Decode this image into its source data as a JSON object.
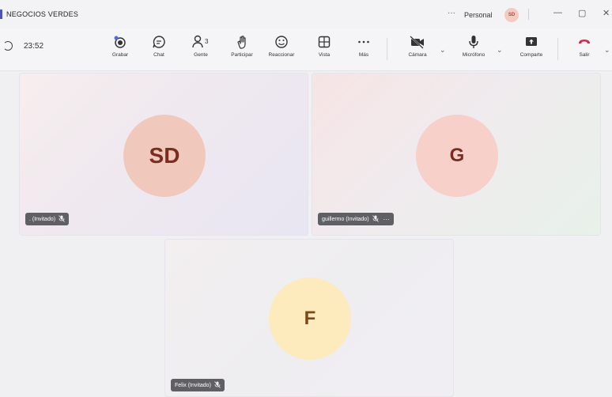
{
  "window": {
    "title": "NEGOCIOS VERDES",
    "more_label": "···",
    "account_label": "Personal",
    "account_initials": "SD",
    "minimize_glyph": "—",
    "maximize_glyph": "▢",
    "close_glyph": "✕"
  },
  "toolbar": {
    "elapsed_time": "23:52",
    "buttons": [
      {
        "label": "Grabar",
        "icon": "record-icon"
      },
      {
        "label": "Chat",
        "icon": "chat-icon"
      },
      {
        "label": "Gente",
        "icon": "people-icon",
        "badge": "3"
      },
      {
        "label": "Participar",
        "icon": "raise-hand-icon"
      },
      {
        "label": "Reaccionar",
        "icon": "smiley-icon"
      },
      {
        "label": "Vista",
        "icon": "grid-view-icon"
      },
      {
        "label": "Más",
        "icon": "more-icon"
      },
      {
        "label": "Cámara",
        "icon": "camera-off-icon"
      },
      {
        "label": "Micrófono",
        "icon": "microphone-icon"
      },
      {
        "label": "Comparte",
        "icon": "share-screen-icon"
      },
      {
        "label": "Salir",
        "icon": "hang-up-icon"
      }
    ],
    "colors": {
      "leave": "#c4314b",
      "record_dot": "#4f6bed"
    }
  },
  "participants": [
    {
      "initials": "SD",
      "name_label": ". (Invitado)",
      "muted": true,
      "color": "#f0c8bc"
    },
    {
      "initials": "G",
      "name_label": "guillermo (Invitado)",
      "muted": true,
      "color": "#f6d0c9",
      "more": "···"
    },
    {
      "initials": "F",
      "name_label": "Felix (Invitado)",
      "muted": true,
      "color": "#fdebbd"
    }
  ]
}
